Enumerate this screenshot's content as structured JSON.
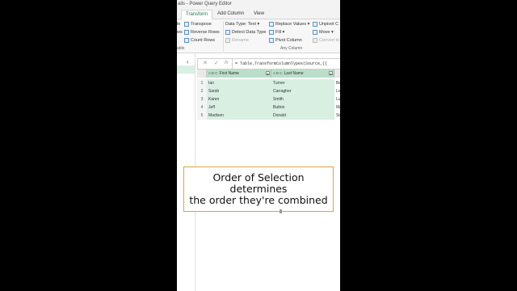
{
  "window": {
    "title": "ails - Power Query Editor"
  },
  "tabs": [
    {
      "label": "Transform",
      "active": true
    },
    {
      "label": "Add Column",
      "active": false
    },
    {
      "label": "View",
      "active": false
    }
  ],
  "ribbon": {
    "left_fragments": [
      "le",
      "ws",
      "able"
    ],
    "table_group": [
      "Transpose",
      "Reverse Rows",
      "Count Rows"
    ],
    "datatype_group": [
      "Data Type: Text ▾",
      "Detect Data Type",
      "Rename"
    ],
    "any_column": [
      "Replace Values ▾",
      "Fill ▾",
      "Pivot Column"
    ],
    "unpivot": [
      "Unpivot C",
      "Move ▾",
      "Convert to"
    ],
    "group_label": "Any Column"
  },
  "formula_bar": {
    "cancel": "✕",
    "confirm": "✓",
    "fx": "fx",
    "text": "= Table.TransformColumnTypes(Source,{{"
  },
  "grid": {
    "columns": [
      {
        "type": "A B C",
        "name": "First Name"
      },
      {
        "type": "A B C",
        "name": "Last Name"
      },
      {
        "type": "",
        "name": ""
      }
    ],
    "rows": [
      {
        "n": "1",
        "first": "Ian",
        "last": "Turner",
        "extra": "Ber"
      },
      {
        "n": "2",
        "first": "Sarah",
        "last": "Carragher",
        "extra": "Lon"
      },
      {
        "n": "3",
        "first": "Karen",
        "last": "Smith",
        "extra": "Luc"
      },
      {
        "n": "4",
        "first": "Jeff",
        "last": "Button",
        "extra": "Mar"
      },
      {
        "n": "5",
        "first": "Madison",
        "last": "Donald",
        "extra": "Stre"
      }
    ]
  },
  "caption": {
    "line1": "Order of Selection",
    "line2": "determines",
    "line3": "the order they're combined"
  },
  "colors": {
    "selected_header": "#b9dfc9",
    "selected_cell": "#d8efe2",
    "caption_border": "#d9a441",
    "accent": "#217346"
  }
}
